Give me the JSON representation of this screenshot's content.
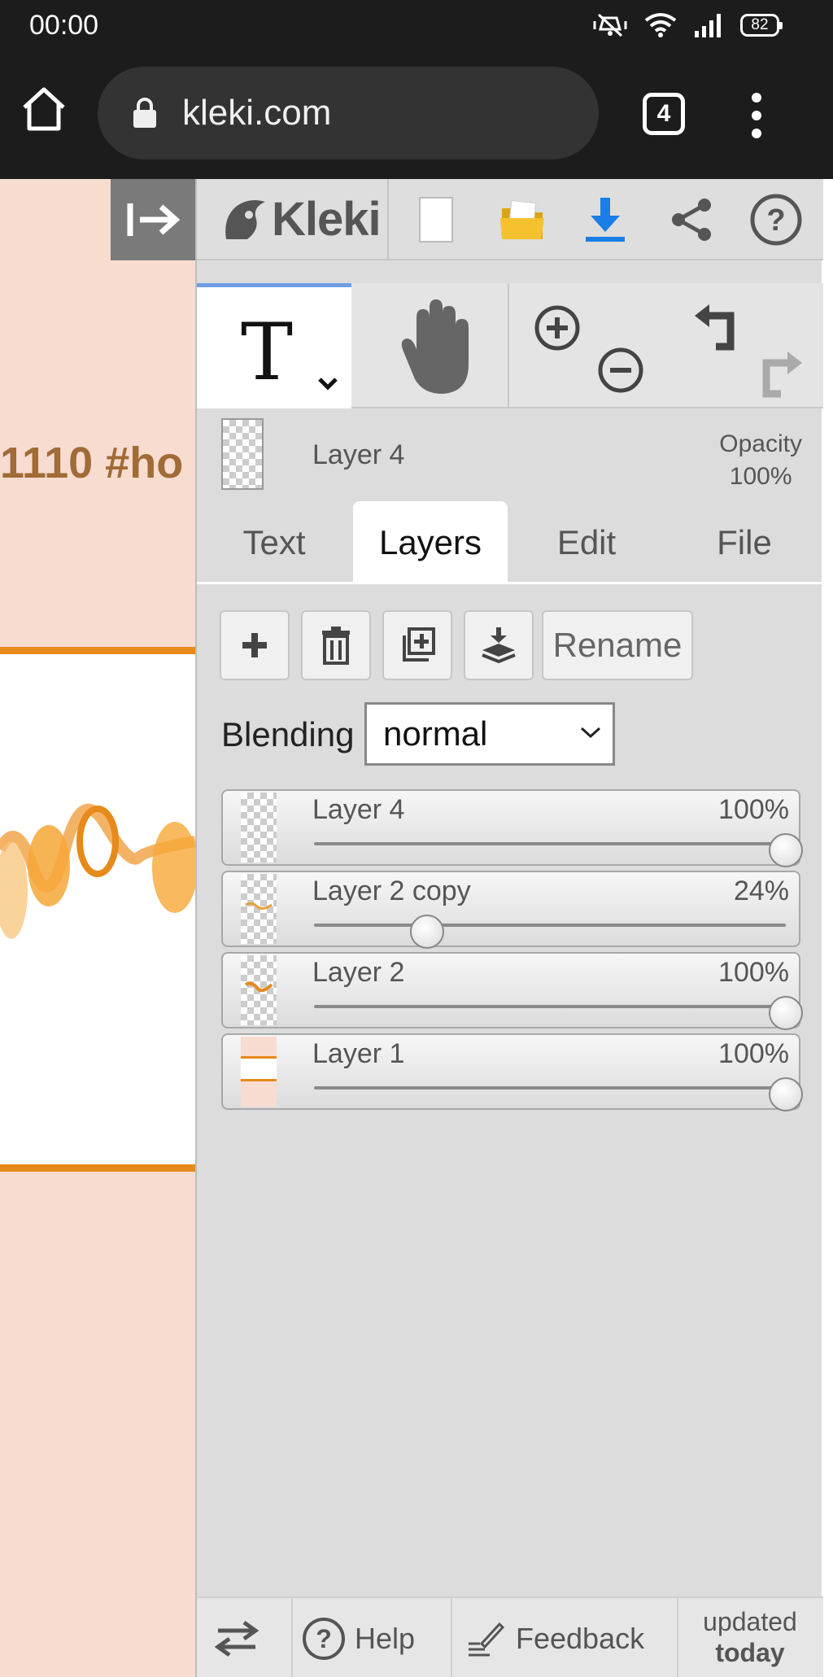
{
  "status_bar": {
    "time": "00:00",
    "battery": "82"
  },
  "browser": {
    "url": "kleki.com",
    "tab_count": "4"
  },
  "canvas": {
    "visible_text": "1110 #ho"
  },
  "app": {
    "logo_text": "Kleki",
    "toolbar": [
      "new-image",
      "open",
      "download",
      "share",
      "help"
    ],
    "tools": [
      "text",
      "hand",
      "zoom-in",
      "zoom-out",
      "undo",
      "redo"
    ]
  },
  "layer_header": {
    "name": "Layer 4",
    "opacity_label": "Opacity",
    "opacity_value": "100%"
  },
  "tabs": [
    {
      "label": "Text",
      "active": false
    },
    {
      "label": "Layers",
      "active": true
    },
    {
      "label": "Edit",
      "active": false
    },
    {
      "label": "File",
      "active": false
    }
  ],
  "actions": {
    "rename_label": "Rename"
  },
  "blending": {
    "label": "Blending",
    "value": "normal"
  },
  "layers": [
    {
      "name": "Layer 4",
      "opacity_label": "100%",
      "opacity": 1.0,
      "selected": true
    },
    {
      "name": "Layer 2 copy",
      "opacity_label": "24%",
      "opacity": 0.24,
      "selected": false
    },
    {
      "name": "Layer 2",
      "opacity_label": "100%",
      "opacity": 1.0,
      "selected": false
    },
    {
      "name": "Layer 1",
      "opacity_label": "100%",
      "opacity": 1.0,
      "selected": false
    }
  ],
  "bottom_bar": {
    "help_label": "Help",
    "feedback_label": "Feedback",
    "updated_line1": "updated",
    "updated_line2": "today"
  },
  "colors": {
    "accent_blue": "#5a8de6",
    "canvas_orange": "#e68a1c",
    "canvas_bg": "#f8dcd0"
  }
}
